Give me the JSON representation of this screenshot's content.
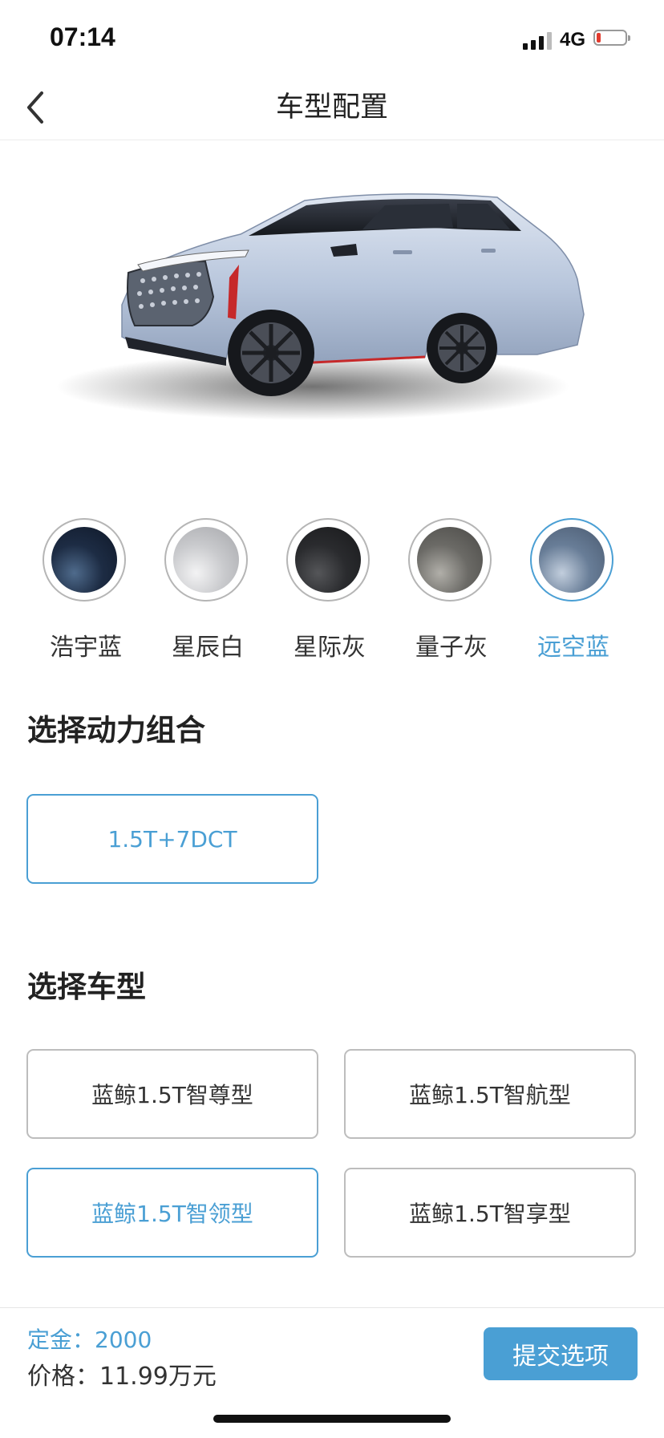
{
  "status_bar": {
    "time": "07:14",
    "network": "4G",
    "battery_level": 0.15
  },
  "nav": {
    "title": "车型配置",
    "back_icon": "chevron-left-icon"
  },
  "hero": {
    "image": "car-image"
  },
  "colors": {
    "accent": "#4a9fd4",
    "options": [
      {
        "label": "浩宇蓝",
        "swatch": "#1d2c44",
        "selected": false
      },
      {
        "label": "星辰白",
        "swatch": "#c9cacd",
        "selected": false
      },
      {
        "label": "星际灰",
        "swatch": "#2a2b2e",
        "selected": false
      },
      {
        "label": "量子灰",
        "swatch": "#6b6a66",
        "selected": false
      },
      {
        "label": "远空蓝",
        "swatch": "#687d97",
        "selected": true
      }
    ]
  },
  "powertrain": {
    "title": "选择动力组合",
    "options": [
      {
        "label": "1.5T+7DCT",
        "selected": true
      }
    ]
  },
  "model": {
    "title": "选择车型",
    "options": [
      {
        "label": "蓝鲸1.5T智尊型",
        "selected": false
      },
      {
        "label": "蓝鲸1.5T智航型",
        "selected": false
      },
      {
        "label": "蓝鲸1.5T智领型",
        "selected": true
      },
      {
        "label": "蓝鲸1.5T智享型",
        "selected": false
      }
    ]
  },
  "footer": {
    "deposit_text": "定金：2000",
    "price_text": "价格：11.99万元",
    "submit_label": "提交选项"
  }
}
